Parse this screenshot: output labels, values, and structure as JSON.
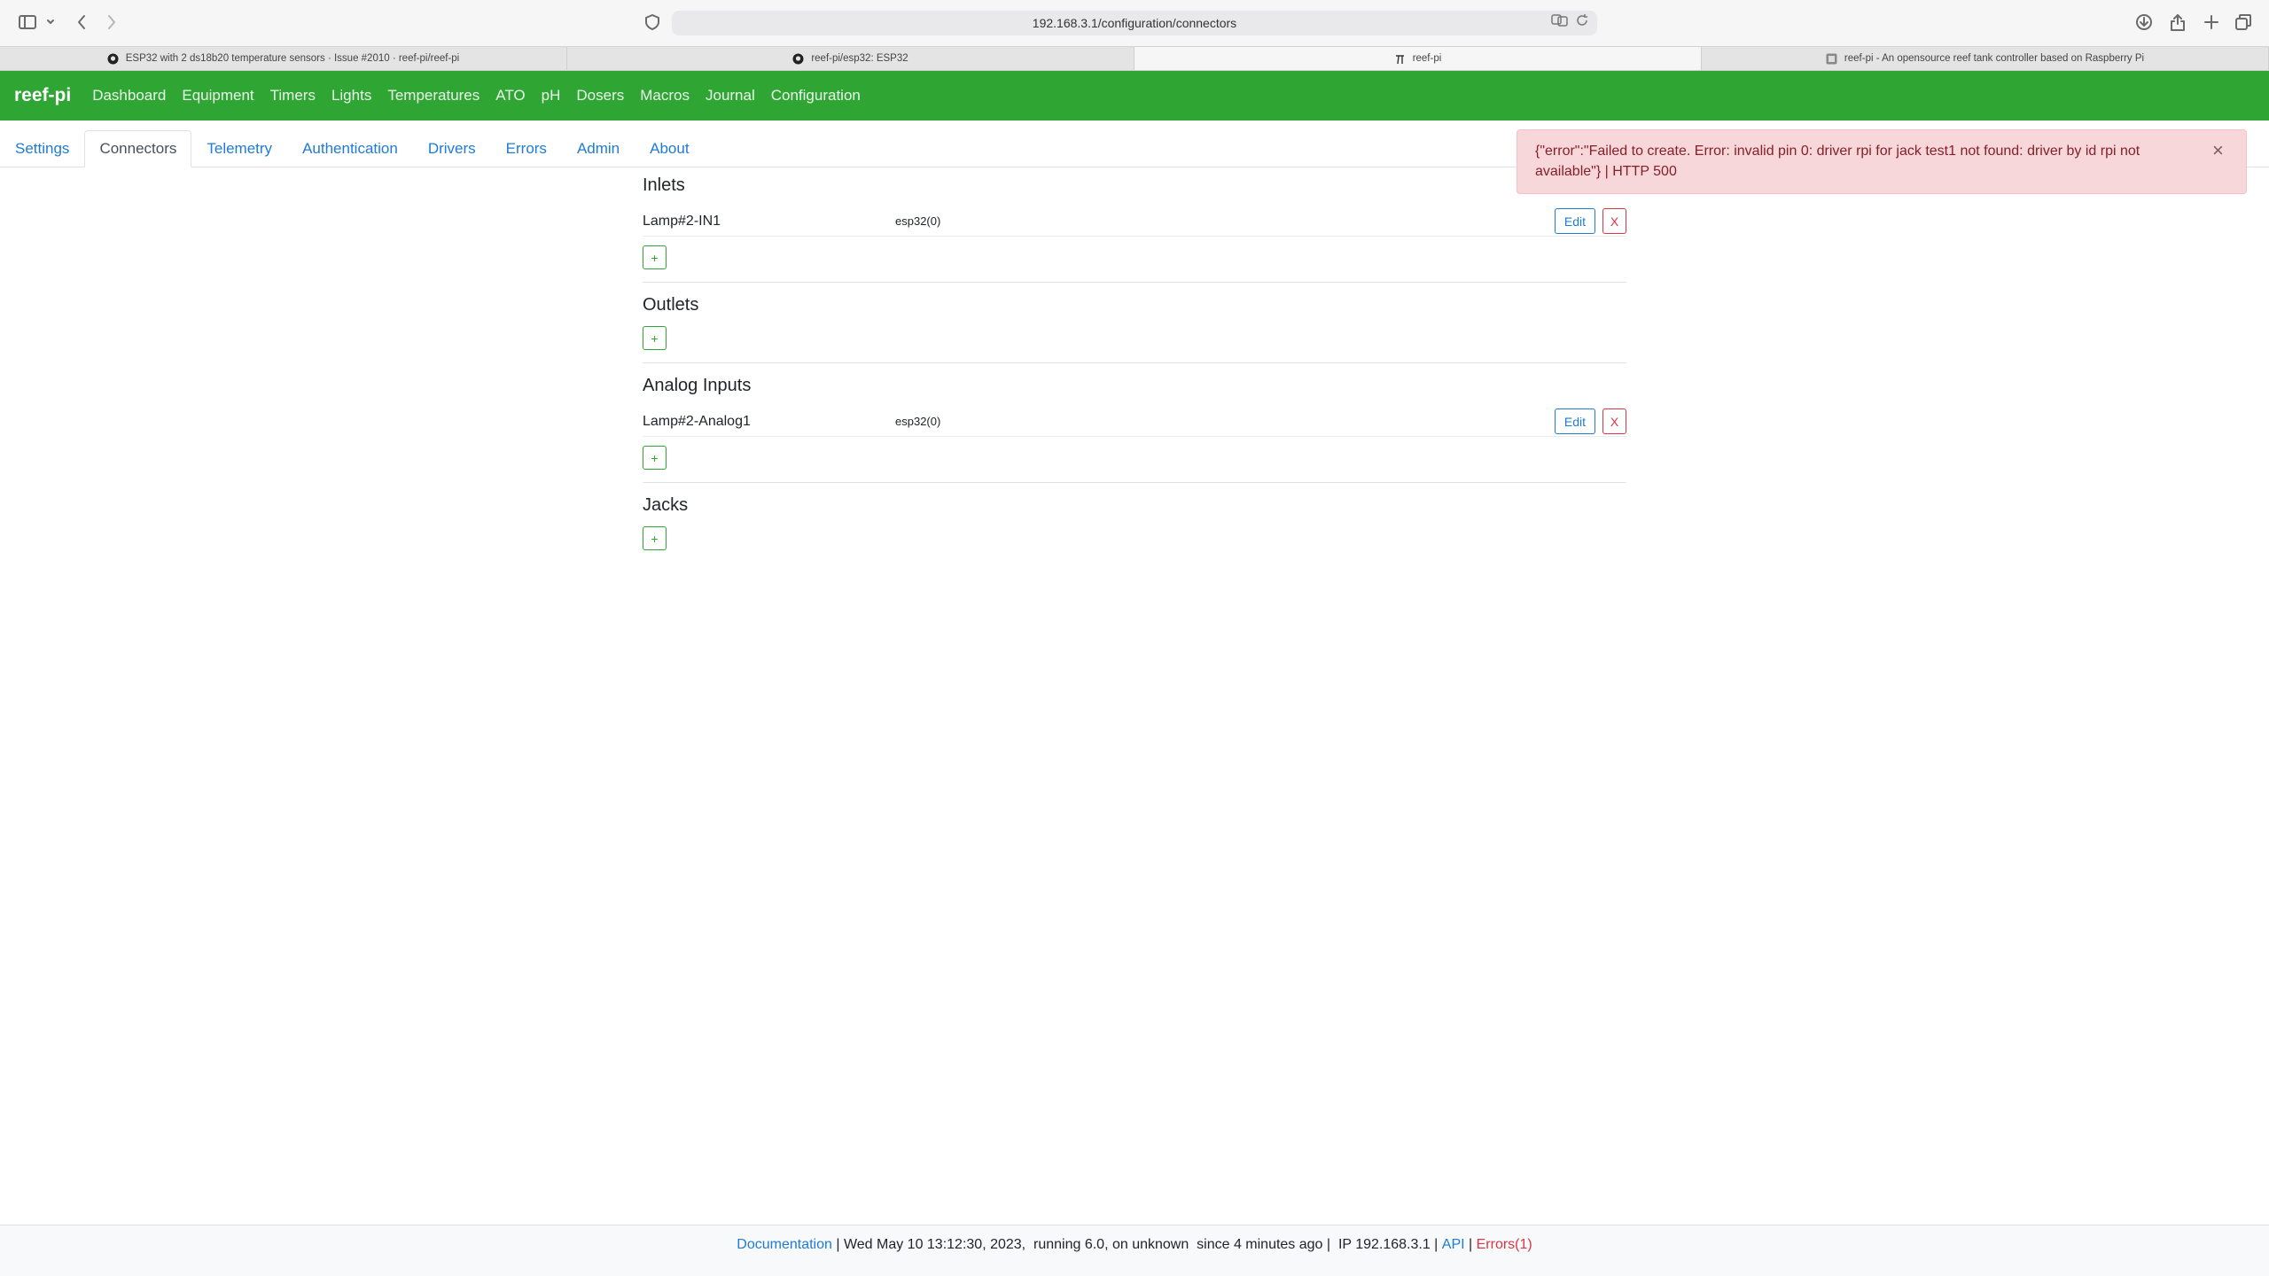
{
  "browser": {
    "url": "192.168.3.1/configuration/connectors",
    "tabs": [
      {
        "title": "ESP32 with 2 ds18b20 temperature sensors · Issue #2010 · reef-pi/reef-pi",
        "icon": "github-icon",
        "active": false
      },
      {
        "title": "reef-pi/esp32: ESP32",
        "icon": "github-icon",
        "active": false
      },
      {
        "title": "reef-pi",
        "icon": "reef-pi-icon",
        "active": true
      },
      {
        "title": "reef-pi - An opensource reef tank controller based on Raspberry Pi",
        "icon": "site-icon",
        "active": false
      }
    ]
  },
  "navbar": {
    "brand": "reef-pi",
    "links": [
      "Dashboard",
      "Equipment",
      "Timers",
      "Lights",
      "Temperatures",
      "ATO",
      "pH",
      "Dosers",
      "Macros",
      "Journal",
      "Configuration"
    ]
  },
  "subtabs": {
    "items": [
      "Settings",
      "Connectors",
      "Telemetry",
      "Authentication",
      "Drivers",
      "Errors",
      "Admin",
      "About"
    ],
    "active": "Connectors"
  },
  "alert": {
    "message": "{\"error\":\"Failed to create. Error: invalid pin 0: driver rpi for jack test1 not found: driver by id rpi not available\"} | HTTP 500",
    "close": "×"
  },
  "sections": {
    "inlets": {
      "title": "Inlets",
      "row": {
        "name": "Lamp#2-IN1",
        "meta": "esp32(0)"
      }
    },
    "outlets": {
      "title": "Outlets"
    },
    "analog": {
      "title": "Analog Inputs",
      "row": {
        "name": "Lamp#2-Analog1",
        "meta": "esp32(0)"
      }
    },
    "jacks": {
      "title": "Jacks"
    }
  },
  "buttons": {
    "edit": "Edit",
    "delete": "X",
    "add": "+"
  },
  "footer": {
    "documentation": "Documentation",
    "sep1": " | ",
    "status": "Wed May 10 13:12:30, 2023,  running 6.0, on unknown  since 4 minutes ago |  IP 192.168.3.1 | ",
    "api": "API",
    "sep2": " | ",
    "errors": "Errors(1)"
  },
  "colors": {
    "navbar": "#2fa534",
    "link": "#1e7bd6",
    "danger": "#dc3545",
    "alert_bg": "#f8d7da"
  }
}
